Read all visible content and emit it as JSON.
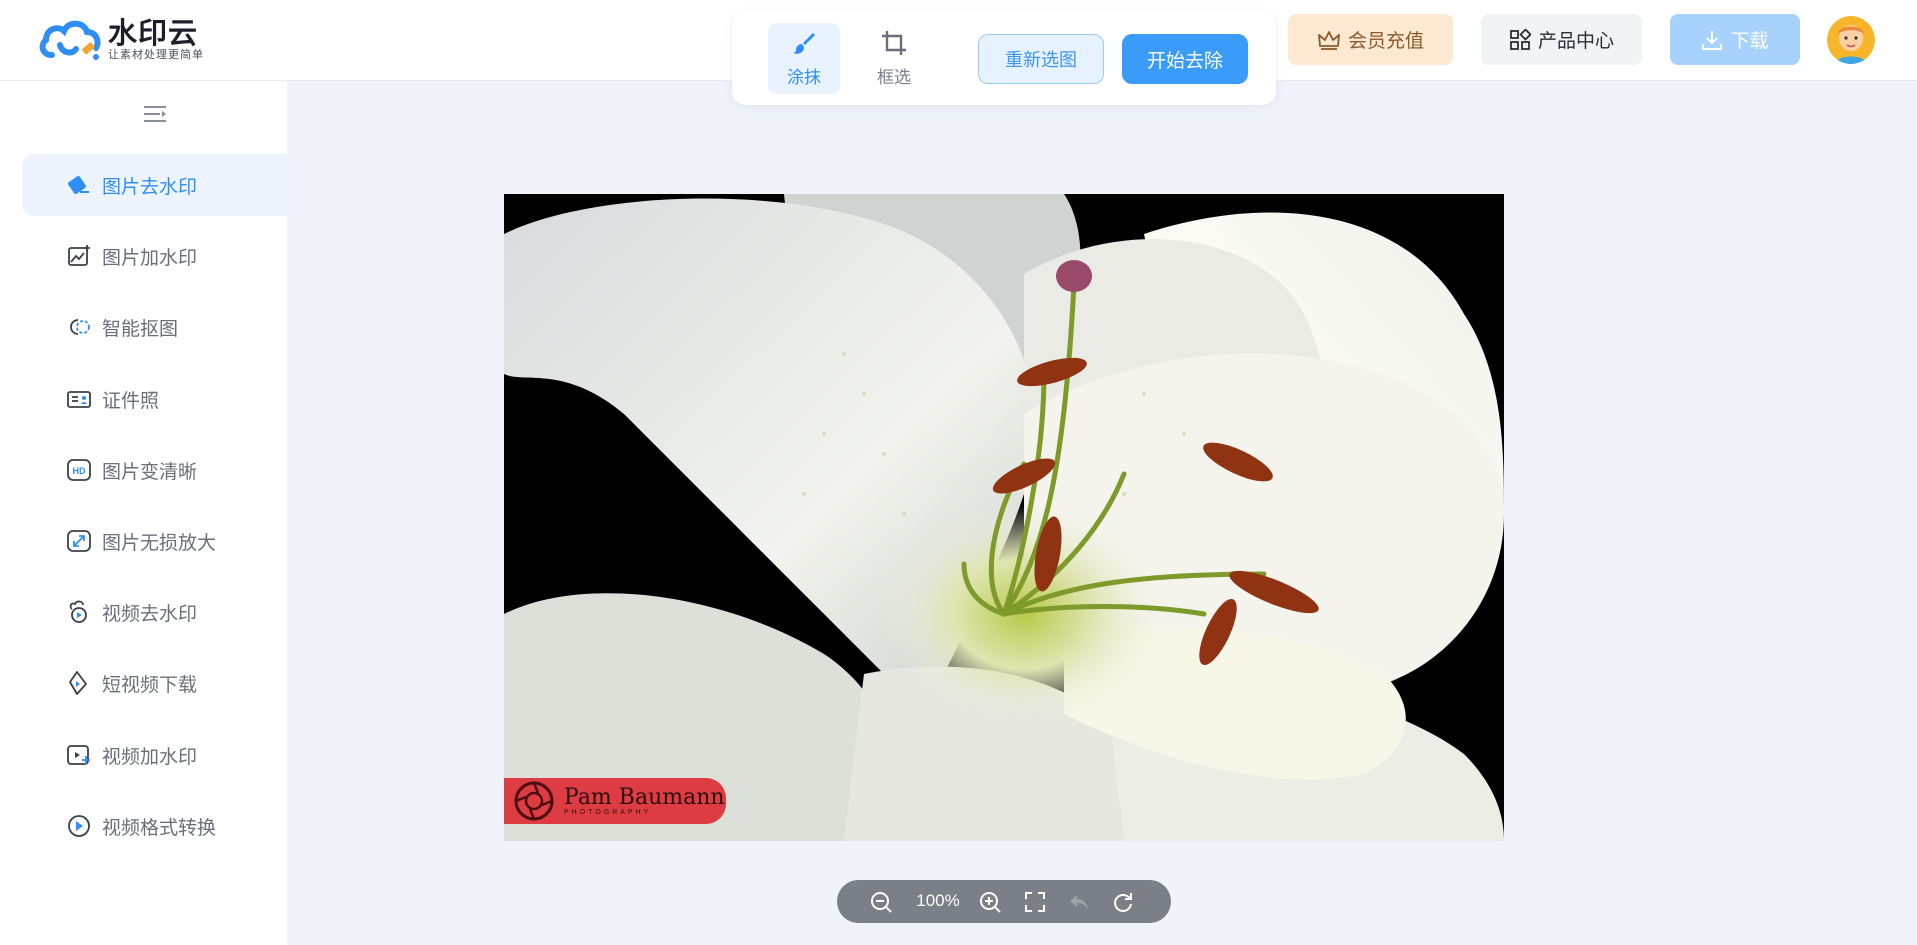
{
  "brand": {
    "name": "水印云",
    "slogan": "让素材处理更简单",
    "color": "#2e8ef5"
  },
  "toolbar": {
    "modes": [
      {
        "label": "涂抹",
        "icon": "brush-icon",
        "active": true
      },
      {
        "label": "框选",
        "icon": "crop-icon",
        "active": false
      }
    ],
    "reselect_label": "重新选图",
    "start_label": "开始去除"
  },
  "header": {
    "vip_label": "会员充值",
    "products_label": "产品中心",
    "download_label": "下载"
  },
  "sidebar": {
    "items": [
      {
        "label": "图片去水印",
        "icon": "image-eraser-icon",
        "active": true
      },
      {
        "label": "图片加水印",
        "icon": "image-add-watermark-icon",
        "active": false
      },
      {
        "label": "智能抠图",
        "icon": "cutout-icon",
        "active": false
      },
      {
        "label": "证件照",
        "icon": "id-photo-icon",
        "active": false
      },
      {
        "label": "图片变清晰",
        "icon": "hd-icon",
        "active": false
      },
      {
        "label": "图片无损放大",
        "icon": "enlarge-icon",
        "active": false
      },
      {
        "label": "视频去水印",
        "icon": "video-eraser-icon",
        "active": false
      },
      {
        "label": "短视频下载",
        "icon": "video-download-icon",
        "active": false
      },
      {
        "label": "视频加水印",
        "icon": "video-add-watermark-icon",
        "active": false
      },
      {
        "label": "视频格式转换",
        "icon": "video-convert-icon",
        "active": false
      }
    ]
  },
  "image": {
    "watermark_name": "Pam Baumann",
    "watermark_sub": "PHOTOGRAPHY"
  },
  "zoom": {
    "value": "100%"
  },
  "colors": {
    "accent": "#3a9cf8",
    "vip_bg": "#fde8d2",
    "canvas_bg": "#f0f3fa"
  }
}
